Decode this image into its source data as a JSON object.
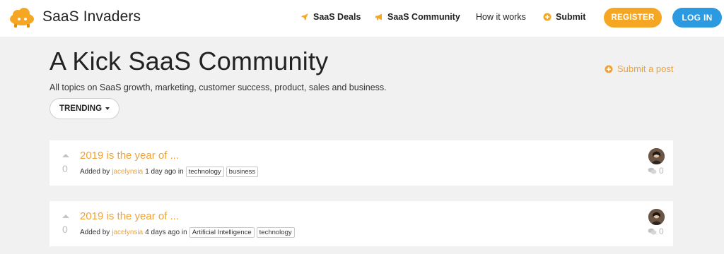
{
  "header": {
    "brand": "SaaS Invaders",
    "nav": [
      {
        "label": "SaaS Deals",
        "icon": "rocket-icon"
      },
      {
        "label": "SaaS Community",
        "icon": "megaphone-icon"
      },
      {
        "label": "How it works"
      },
      {
        "label": "Submit",
        "icon": "plus-circle-icon"
      }
    ],
    "register_label": "REGISTER",
    "login_label": "LOG IN",
    "colors": {
      "accent": "#f5a623",
      "login": "#2c9ae0"
    }
  },
  "page": {
    "title": "A Kick SaaS Community",
    "subtitle": "All topics on SaaS growth, marketing, customer success, product, sales and business.",
    "submit_label": "Submit a post",
    "sort_label": "TRENDING"
  },
  "posts": [
    {
      "title": "2019 is the year of ...",
      "votes": "0",
      "added_by": "Added by",
      "author": "jacelynsia",
      "time": "1 day ago in",
      "tags": [
        "technology",
        "business"
      ],
      "comments": "0"
    },
    {
      "title": "2019 is the year of ...",
      "votes": "0",
      "added_by": "Added by",
      "author": "jacelynsia",
      "time": "4 days ago in",
      "tags": [
        "Artificial Intelligence",
        "technology"
      ],
      "comments": "0"
    }
  ]
}
